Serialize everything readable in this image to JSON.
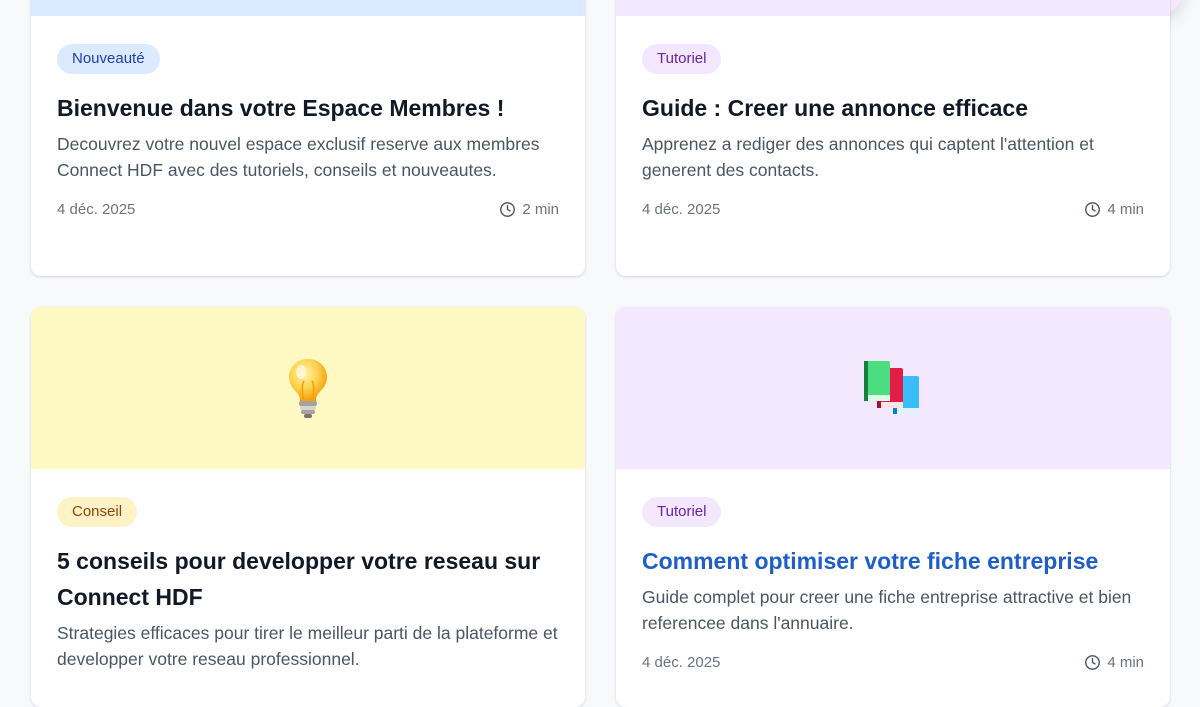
{
  "articles": [
    {
      "badge": "Nouveauté",
      "title": "Bienvenue dans votre Espace Membres !",
      "description": "Decouvrez votre nouvel espace exclusif reserve aux membres Connect HDF avec des tutoriels, conseils et nouveautes.",
      "date": "4 déc. 2025",
      "read_time": "2 min",
      "image_color": "#dbeafe",
      "badge_color": "#dbeafe"
    },
    {
      "badge": "Tutoriel",
      "title": "Guide : Creer une annonce efficace",
      "description": "Apprenez a rediger des annonces qui captent l'attention et generent des contacts.",
      "date": "4 déc. 2025",
      "read_time": "4 min",
      "image_color": "#f3e8ff",
      "badge_color": "#f3e8ff"
    },
    {
      "badge": "Conseil",
      "title": "5 conseils pour developper votre reseau sur Connect HDF",
      "description": "Strategies efficaces pour tirer le meilleur parti de la plateforme et developper votre reseau professionnel.",
      "image_icon": "light-bulb-icon",
      "image_color": "#fef9c3",
      "badge_color": "#fef3c7"
    },
    {
      "badge": "Tutoriel",
      "title": "Comment optimiser votre fiche entreprise",
      "description": "Guide complet pour creer une fiche entreprise attractive et bien referencee dans l'annuaire.",
      "date": "4 déc. 2025",
      "read_time": "4 min",
      "image_icon": "books-icon",
      "image_color": "#f3e8ff",
      "badge_color": "#f3e8ff"
    }
  ]
}
